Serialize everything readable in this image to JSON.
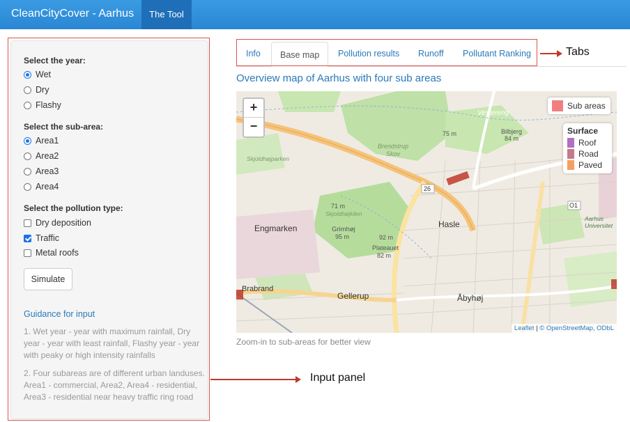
{
  "navbar": {
    "brand": "CleanCityCover - Aarhus",
    "tab": "The Tool"
  },
  "panel": {
    "year_label": "Select the year:",
    "years": [
      {
        "label": "Wet",
        "selected": true
      },
      {
        "label": "Dry",
        "selected": false
      },
      {
        "label": "Flashy",
        "selected": false
      }
    ],
    "area_label": "Select the sub-area:",
    "areas": [
      {
        "label": "Area1",
        "selected": true
      },
      {
        "label": "Area2",
        "selected": false
      },
      {
        "label": "Area3",
        "selected": false
      },
      {
        "label": "Area4",
        "selected": false
      }
    ],
    "pollution_label": "Select the pollution type:",
    "pollution": [
      {
        "label": "Dry deposition",
        "checked": false
      },
      {
        "label": "Traffic",
        "checked": true
      },
      {
        "label": "Metal roofs",
        "checked": false
      }
    ],
    "simulate_label": "Simulate",
    "guidance_title": "Guidance for input",
    "guidance_1": "1. Wet year - year with maximum rainfall, Dry year - year with least rainfall, Flashy year - year with peaky or high intensity rainfalls",
    "guidance_2": "2. Four subareas are of different urban landuses. Area1 - commercial, Area2, Area4 - residential, Area3 - residential near heavy traffic ring road"
  },
  "tabs": [
    "Info",
    "Base map",
    "Pollution results",
    "Runoff",
    "Pollutant Ranking"
  ],
  "active_tab": "Base map",
  "map": {
    "title": "Overview map of Aarhus with four sub areas",
    "zoom_in": "+",
    "zoom_out": "−",
    "legend_subareas": "Sub areas",
    "legend_subareas_color": "#f08080",
    "surface_title": "Surface",
    "surfaces": [
      {
        "label": "Roof",
        "color": "#b070c0"
      },
      {
        "label": "Road",
        "color": "#c47a8a"
      },
      {
        "label": "Paved",
        "color": "#f5a060"
      }
    ],
    "labels": {
      "vestereng": "Vestereng",
      "bilbjerg": "Bilbjerg",
      "m84": "84 m",
      "m75": "75 m",
      "brendstrup": "Brendstrup",
      "skov": "Skov",
      "skjold": "Skjoldhøjparken",
      "engmarken": "Engmarken",
      "skjoldh": "Skjoldhøjkilen",
      "m71": "71 m",
      "grimhoj": "Grimhøj",
      "m95": "95 m",
      "m92": "92 m",
      "plateauet": "Plateauet",
      "m82": "82 m",
      "hasle": "Hasle",
      "brabrand": "Brabrand",
      "gellerup": "Gellerup",
      "abyhoj": "Åbyhøj",
      "o1": "O1",
      "r26": "26",
      "aarhus_univ": "Aarhus Universitet"
    },
    "attribution_leaflet": "Leaflet",
    "attribution_osm": "© OpenStreetMap, ODbL",
    "caption": "Zoom-in to sub-areas for better view"
  },
  "annotations": {
    "tabs": "Tabs",
    "input_panel": "Input panel"
  }
}
